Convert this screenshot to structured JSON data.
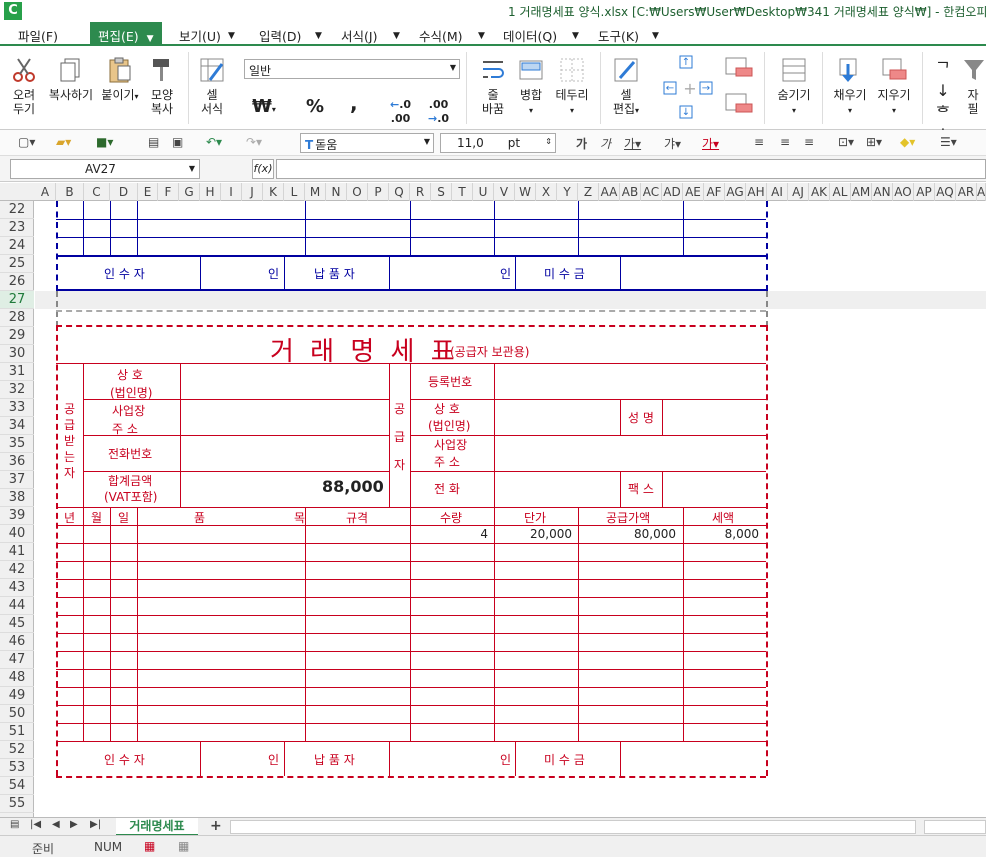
{
  "window": {
    "title": "1 거래명세표 양식.xlsx [C:₩Users₩User₩Desktop₩341 거래명세표 양식₩] - 한컴오피",
    "logo": "C"
  },
  "menu": [
    {
      "label": "파일(F)"
    },
    {
      "label": "편집(E)"
    },
    {
      "label": "보기(U)"
    },
    {
      "label": "입력(D)"
    },
    {
      "label": "서식(J)"
    },
    {
      "label": "수식(M)"
    },
    {
      "label": "데이터(Q)"
    },
    {
      "label": "도구(K)"
    }
  ],
  "ribbon": {
    "cut": "오려\n두기",
    "copy": "복사하기",
    "paste": "붙이기",
    "format_copy": "모양\n복사",
    "cell_format": "셀\n서식",
    "number_format": "일반",
    "wrap": "줄\n바꿈",
    "merge": "병합",
    "border": "테두리",
    "cell_edit": "셀\n편집",
    "hide": "숨기기",
    "fill": "채우기",
    "clear": "지우기",
    "sort": "자\n필",
    "won": "₩",
    "percent": "%",
    "comma": ","
  },
  "toolbar2": {
    "font": "돋움",
    "size": "11,0",
    "unit": "pt"
  },
  "formula": {
    "namebox": "AV27",
    "fx": "f(x)",
    "value": ""
  },
  "columns": [
    "A",
    "B",
    "C",
    "D",
    "E",
    "F",
    "G",
    "H",
    "I",
    "J",
    "K",
    "L",
    "M",
    "N",
    "O",
    "P",
    "Q",
    "R",
    "S",
    "T",
    "U",
    "V",
    "W",
    "X",
    "Y",
    "Z",
    "AA",
    "AB",
    "AC",
    "AD",
    "AE",
    "AF",
    "AG",
    "AH",
    "AI",
    "AJ",
    "AK",
    "AL",
    "AM",
    "AN",
    "AO",
    "AP",
    "AQ",
    "AR",
    "A"
  ],
  "rows": [
    "22",
    "23",
    "24",
    "25",
    "26",
    "27",
    "28",
    "29",
    "30",
    "31",
    "32",
    "33",
    "34",
    "35",
    "36",
    "37",
    "38",
    "39",
    "40",
    "41",
    "42",
    "43",
    "44",
    "45",
    "46",
    "47",
    "48",
    "49",
    "50",
    "51",
    "52",
    "53",
    "54",
    "55"
  ],
  "selected_row": "27",
  "upper_form": {
    "receiver": "인 수 자",
    "seal": "인",
    "deliverer": "납 품 자",
    "seal2": "인",
    "unpaid": "미 수 금"
  },
  "invoice": {
    "title": "거 래 명 세 표",
    "subtitle": "(공급자 보관용)",
    "buyer_label": "공급받는자",
    "supplier_label": "공 급 자",
    "fields": {
      "company": "상    호",
      "company_sub": "(법인명)",
      "address": "사업장",
      "address_sub": "주    소",
      "phone": "전화번호",
      "total": "합계금액",
      "total_sub": "(VAT포함)",
      "total_value": "88,000",
      "reg_no": "등록번호",
      "s_company": "상    호",
      "s_company_sub": "(법인명)",
      "name": "성  명",
      "s_address": "사업장",
      "s_address_sub": "주    소",
      "s_phone": "전    화",
      "fax": "팩  스"
    },
    "headers": {
      "year": "년",
      "month": "월",
      "day": "일",
      "item": "품",
      "item2": "목",
      "spec": "규격",
      "qty": "수량",
      "price": "단가",
      "supply": "공급가액",
      "tax": "세액"
    },
    "line1": {
      "qty": "4",
      "price": "20,000",
      "supply": "80,000",
      "tax": "8,000"
    },
    "footer": {
      "receiver": "인 수 자",
      "seal": "인",
      "deliverer": "납 품 자",
      "seal2": "인",
      "unpaid": "미 수 금"
    }
  },
  "sheet": {
    "tab": "거래명세표",
    "add": "+"
  },
  "status": {
    "ready": "준비",
    "num": "NUM"
  }
}
